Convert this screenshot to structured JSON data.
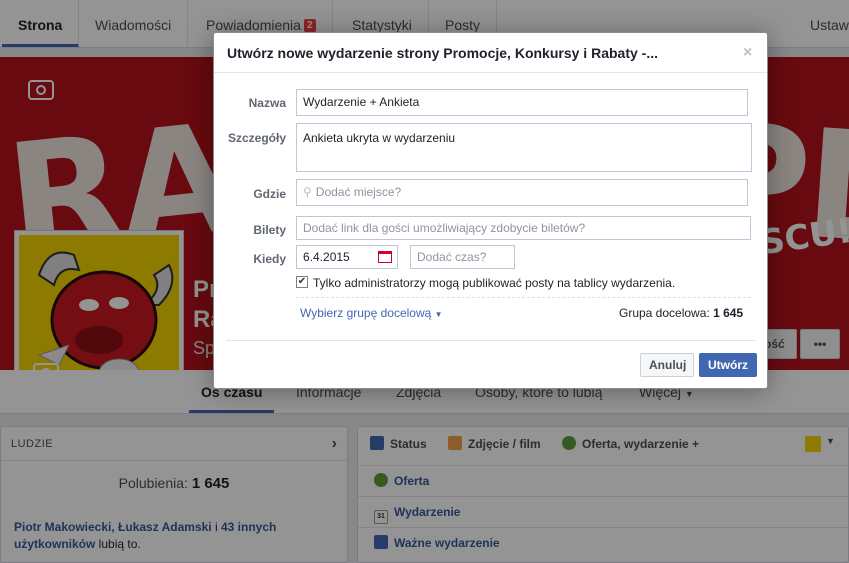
{
  "top_tabs": {
    "strona": "Strona",
    "wiadomosci": "Wiadomości",
    "powiadomienia": "Powiadomienia",
    "powiadomienia_count": "2",
    "statystyki": "Statystyki",
    "posty": "Posty",
    "ustawienia": "Ustaw"
  },
  "cover": {
    "word_left": "RAB",
    "word_right": "PL",
    "slogan": "SCU!"
  },
  "profile_name": {
    "line1": "Pr",
    "line2": "Ra",
    "subtitle": "Sp"
  },
  "cover_buttons": {
    "partial_label": "ość",
    "more": "•••"
  },
  "page_nav": {
    "timeline": "Oś czasu",
    "info": "Informacje",
    "photos": "Zdjęcia",
    "likes": "Osoby, które to lubią",
    "more": "Więcej"
  },
  "people": {
    "header": "LUDZIE",
    "likes_label": "Polubienia:",
    "likes_count": "1 645",
    "friends_names": "Piotr Makowiecki, Łukasz Adamski",
    "friends_conj": " i ",
    "friends_others": "43 innych użytkowników",
    "friends_suffix": " lubią to."
  },
  "composer": {
    "status": "Status",
    "photo": "Zdjęcie / film",
    "offer_event": "Oferta, wydarzenie +",
    "rows": [
      "Oferta",
      "Wydarzenie",
      "Ważne wydarzenie"
    ],
    "calendar_day": "31"
  },
  "dialog": {
    "title": "Utwórz nowe wydarzenie strony Promocje, Konkursy i Rabaty -...",
    "close": "×",
    "name_label": "Nazwa",
    "name_value": "Wydarzenie + Ankieta",
    "details_label": "Szczegóły",
    "details_value": "Ankieta ukryta w wydarzeniu",
    "where_label": "Gdzie",
    "where_placeholder": "Dodać miejsce?",
    "tickets_label": "Bilety",
    "tickets_placeholder": "Dodać link dla gości umożliwiający zdobycie biletów?",
    "when_label": "Kiedy",
    "date_value": "6.4.2015",
    "time_placeholder": "Dodać czas?",
    "admins_only_label": "Tylko administratorzy mogą publikować posty na tablicy wydarzenia.",
    "admins_only_checked": true,
    "target_group_link": "Wybierz grupę docelową",
    "target_group_label": "Grupa docelowa:",
    "target_group_count": "1 645",
    "cancel": "Anuluj",
    "create": "Utwórz"
  },
  "colors": {
    "primary": "#4267b2",
    "link": "#365899",
    "cover_red": "#b3121a",
    "badge_red": "#fa3e3e",
    "profile_yellow": "#f2d400"
  }
}
